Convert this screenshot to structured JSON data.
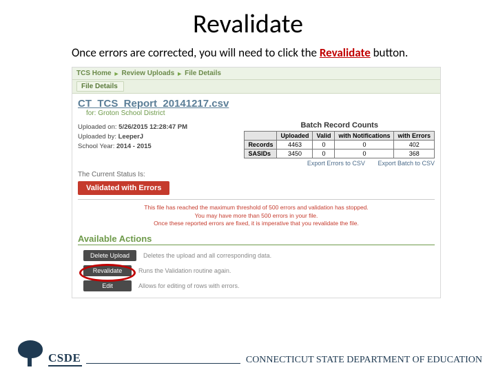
{
  "title": "Revalidate",
  "instruction_pre": "Once errors are corrected, you will need to click the ",
  "instruction_hl": "Revalidate",
  "instruction_post": " button.",
  "breadcrumbs": {
    "a": "TCS Home",
    "b": "Review Uploads",
    "c": "File Details"
  },
  "file_details_label": "File Details",
  "filename": "CT_TCS_Report_20141217.csv",
  "for_line": "for: Groton School District",
  "meta": {
    "uploaded_on_label": "Uploaded on:",
    "uploaded_on": "5/26/2015 12:28:47 PM",
    "uploaded_by_label": "Uploaded by:",
    "uploaded_by": "LeeperJ",
    "school_year_label": "School Year:",
    "school_year": "2014 - 2015"
  },
  "brc": {
    "title": "Batch Record Counts",
    "headers": {
      "blank": "",
      "uploaded": "Uploaded",
      "valid": "Valid",
      "notif": "with Notifications",
      "errors": "with Errors"
    },
    "rows": [
      {
        "label": "Records",
        "uploaded": "4463",
        "valid": "0",
        "notif": "0",
        "errors": "402"
      },
      {
        "label": "SASIDs",
        "uploaded": "3450",
        "valid": "0",
        "notif": "0",
        "errors": "368"
      }
    ],
    "export_errors": "Export Errors to CSV",
    "export_batch": "Export Batch to CSV"
  },
  "status": {
    "label": "The Current Status Is:",
    "value": "Validated with Errors"
  },
  "warning": {
    "l1": "This file has reached the maximum threshold of 500 errors and validation has stopped.",
    "l2": "You may have more than 500 errors in your file.",
    "l3": "Once these reported errors are fixed, it is imperative that you revalidate the file."
  },
  "actions": {
    "title": "Available Actions",
    "items": [
      {
        "label": "Delete Upload",
        "desc": "Deletes the upload and all corresponding data."
      },
      {
        "label": "Revalidate",
        "desc": "Runs the Validation routine again."
      },
      {
        "label": "Edit",
        "desc": "Allows for editing of rows with errors."
      }
    ]
  },
  "footer": {
    "logo_text": "CSDE",
    "org": "CONNECTICUT STATE DEPARTMENT OF EDUCATION"
  }
}
